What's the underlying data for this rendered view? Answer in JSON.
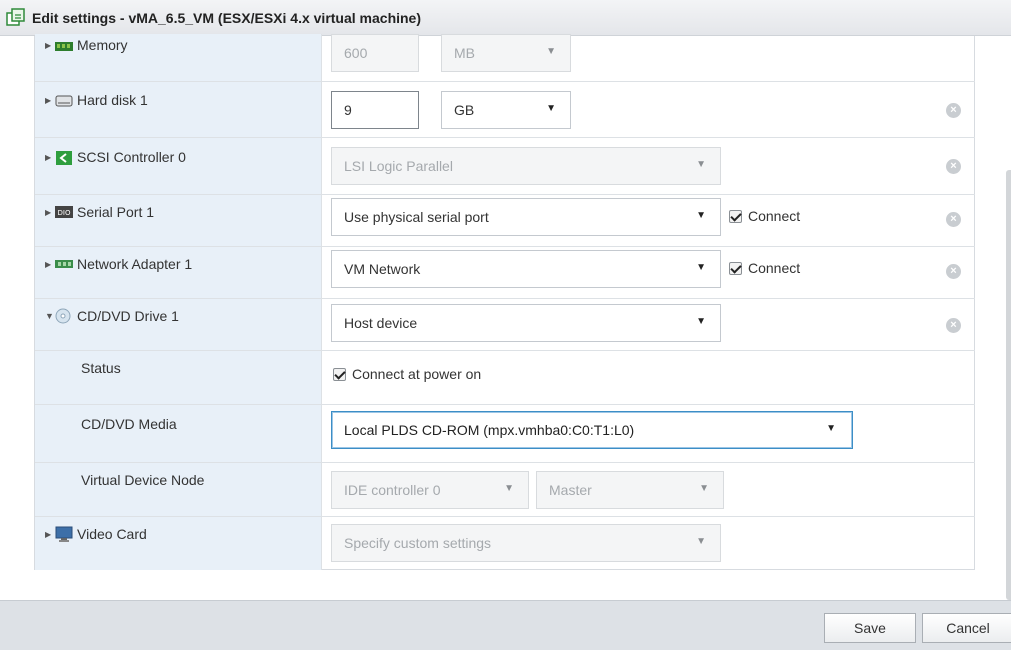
{
  "window": {
    "title": "Edit settings - vMA_6.5_VM (ESX/ESXi 4.x virtual machine)"
  },
  "colors": {
    "label_bg": "#e8f0f8",
    "focus_border": "#3c8ec6",
    "footer_bg": "#dde1e6"
  },
  "devices": {
    "memory": {
      "label": "Memory",
      "value": "600",
      "unit": "MB",
      "icon": "memory-icon"
    },
    "hard_disk": {
      "label": "Hard disk 1",
      "value": "9",
      "unit": "GB",
      "icon": "hard-disk-icon"
    },
    "scsi": {
      "label": "SCSI Controller 0",
      "value": "LSI Logic Parallel",
      "icon": "scsi-controller-icon"
    },
    "serial": {
      "label": "Serial Port 1",
      "value": "Use physical serial port",
      "connect_label": "Connect",
      "icon_text": "DIO",
      "icon": "serial-port-icon"
    },
    "network": {
      "label": "Network Adapter 1",
      "value": "VM Network",
      "connect_label": "Connect",
      "icon": "network-adapter-icon"
    },
    "cddvd": {
      "label": "CD/DVD Drive 1",
      "value": "Host device",
      "icon": "cd-dvd-icon",
      "status_label": "Status",
      "status_value": "Connect at power on",
      "media_label": "CD/DVD Media",
      "media_value": "Local PLDS CD-ROM (mpx.vmhba0:C0:T1:L0)",
      "node_label": "Virtual Device Node",
      "node_controller": "IDE controller 0",
      "node_position": "Master"
    },
    "video": {
      "label": "Video Card",
      "value": "Specify custom settings",
      "icon": "video-card-icon"
    }
  },
  "footer": {
    "save_label": "Save",
    "cancel_label": "Cancel"
  }
}
